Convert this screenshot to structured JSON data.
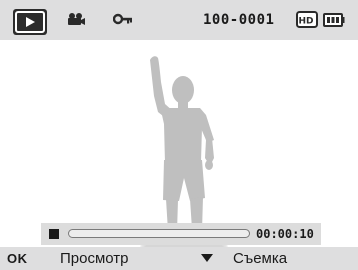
{
  "status_bar": {
    "mode_icon": "play-icon",
    "movie_icon": "movie-camera-icon",
    "protect_icon": "key-icon",
    "file_number": "100-0001",
    "resolution_icon": "hd-icon",
    "resolution_label": "HD",
    "battery_icon": "battery-icon"
  },
  "image": {
    "subject": "child-silhouette"
  },
  "playback": {
    "stop_icon": "stop-icon",
    "progress": 0,
    "time": "00:00:10"
  },
  "bottom_bar": {
    "ok_label": "OK",
    "view_label": "Просмотр",
    "down_icon": "down-arrow-icon",
    "shoot_label": "Съемка"
  },
  "colors": {
    "bar_background": "#dededf",
    "silhouette": "#bfbfbf",
    "text": "#1a1a1a"
  }
}
